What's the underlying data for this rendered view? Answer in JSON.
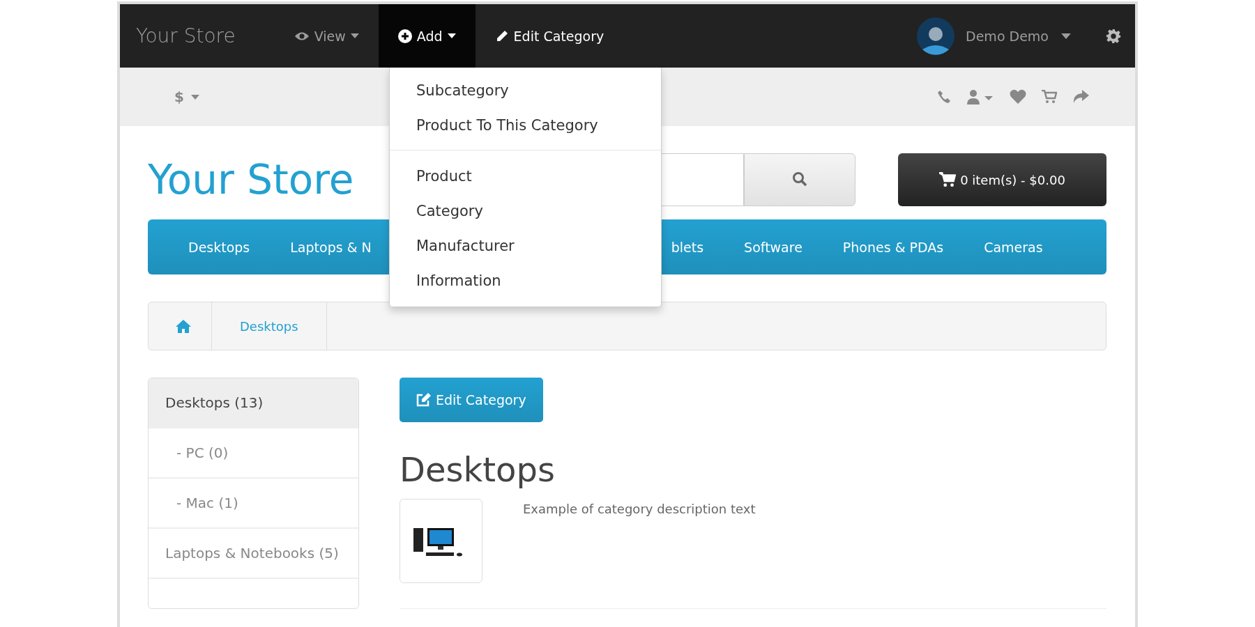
{
  "top_bar": {
    "brand": "Your Store",
    "menus": [
      {
        "label": "View",
        "kind": "dropdown",
        "selected": false
      },
      {
        "label": "Add",
        "kind": "dropdown",
        "selected": true
      },
      {
        "label": "Edit Category",
        "kind": "link",
        "selected": false
      }
    ],
    "user": {
      "name": "Demo Demo"
    }
  },
  "add_menu": {
    "groups": [
      [
        "Subcategory",
        "Product To This Category"
      ],
      [
        "Product",
        "Category",
        "Manufacturer",
        "Information"
      ]
    ]
  },
  "currency": {
    "symbol": "$"
  },
  "header": {
    "logo": "Your Store",
    "cart": "0 item(s) - $0.00"
  },
  "nav": [
    "Desktops",
    "Laptops & N",
    "blets",
    "Software",
    "Phones & PDAs",
    "Cameras"
  ],
  "breadcrumb": [
    "Desktops"
  ],
  "sidebar": [
    {
      "label": "Desktops (13)",
      "selected": true,
      "children": [
        {
          "label": "- PC (0)",
          "selected": false
        },
        {
          "label": "- Mac (1)",
          "selected": false
        }
      ]
    },
    {
      "label": "Laptops & Notebooks (5)",
      "selected": false
    }
  ],
  "content": {
    "edit_button": "Edit Category",
    "heading": "Desktops",
    "description": "Example of category description text"
  }
}
